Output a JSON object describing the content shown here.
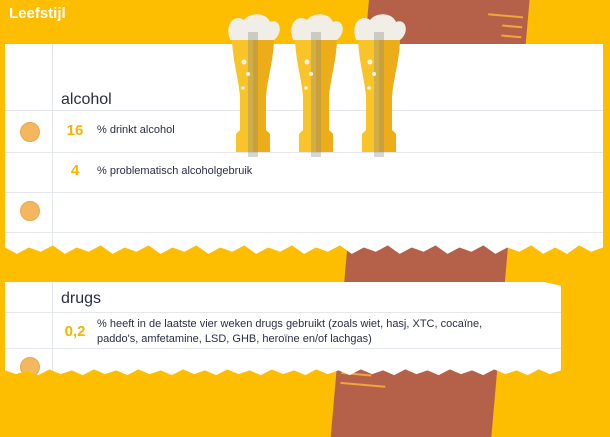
{
  "header": {
    "title": "Leefstijl"
  },
  "colors": {
    "background": "#FDBD00",
    "accent": "#F5B400",
    "text": "#2a2e45",
    "dot": "#F3B760",
    "ruler": "#B5614A"
  },
  "decoration": {
    "beer_glasses_count": 3,
    "icon": "beer-glass-icon"
  },
  "alcohol": {
    "title": "alcohol",
    "stats": [
      {
        "value": "16",
        "label": "% drinkt alcohol"
      },
      {
        "value": "4",
        "label": "% problematisch alcoholgebruik"
      }
    ]
  },
  "drugs": {
    "title": "drugs",
    "stats": [
      {
        "value": "0,2",
        "label_line1": "% heeft in de laatste vier weken drugs gebruikt (zoals wiet, hasj, XTC, cocaïne,",
        "label_line2": "paddo's, amfetamine, LSD, GHB, heroïne en/of lachgas)"
      }
    ]
  }
}
